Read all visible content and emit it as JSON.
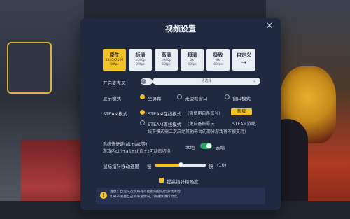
{
  "dialog": {
    "title": "视频设置",
    "close_icon": "close-icon"
  },
  "presets": [
    {
      "name": "原生",
      "res": "3840x2160",
      "fps": "60fps",
      "active": true
    },
    {
      "name": "标清",
      "res": "1080p",
      "fps": "30fps"
    },
    {
      "name": "高清",
      "res": "1080p",
      "fps": "60fps"
    },
    {
      "name": "超清",
      "res": "2k",
      "fps": "60fps"
    },
    {
      "name": "极致",
      "res": "4k",
      "fps": "60fps"
    },
    {
      "name": "自定义",
      "arrow": "→"
    }
  ],
  "mic": {
    "label": "开启麦克风",
    "select_placeholder": "请选择"
  },
  "display": {
    "label": "显示模式",
    "options": [
      "全屏幕",
      "无边框窗口",
      "窗口模式"
    ]
  },
  "steam": {
    "label": "STEAM模式",
    "online_label": "STEAM在线模式",
    "online_note": "(需使用自备账号)",
    "new_badge": "新增",
    "offline_label": "STEAM离线模式",
    "offline_note_1": "(免自备账号玩",
    "offline_note_1b": "STEAM游戏,",
    "offline_note_2": "线下模式需二次启动其他平台的部分游戏将不被支持)"
  },
  "shortcut": {
    "line1": "系统快捷键(alt+tab等)",
    "line2": "游戏内ctrl+alt+shift+z可动态切换",
    "local": "本地",
    "cloud": "云端"
  },
  "mouse": {
    "label": "鼠标指针移动速度",
    "slow": "慢",
    "fast": "快",
    "value": "(10)",
    "level": 0.5
  },
  "precision": {
    "label": "提高指针精确度"
  },
  "notice": {
    "icon": "!",
    "line1": "注意：自定义选项将有可能影响您的云游戏体验!",
    "line2": "如果不清楚自己的带宽情况，请谨慎进行对比。"
  },
  "colors": {
    "accent": "#f2c22a",
    "dialog_bg": "#1f2a40",
    "toggle_on": "#2e9f63"
  }
}
